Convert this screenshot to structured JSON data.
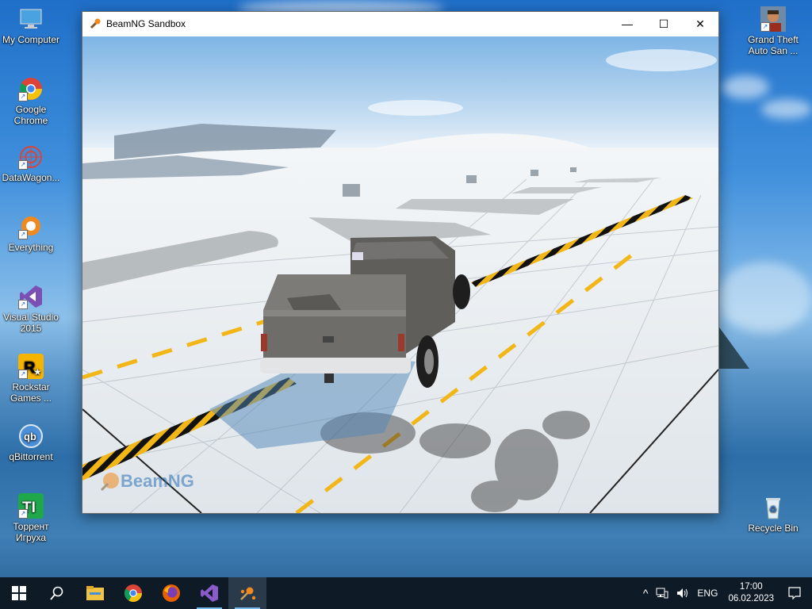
{
  "desktop": {
    "icons_left": [
      {
        "label": "My Computer",
        "icon": "computer-icon"
      },
      {
        "label": "Google Chrome",
        "icon": "chrome-icon"
      },
      {
        "label": "DataWagon...",
        "icon": "datawagon-icon"
      },
      {
        "label": "Everything",
        "icon": "everything-icon"
      },
      {
        "label": "Visual Studio 2015",
        "icon": "visual-studio-icon"
      },
      {
        "label": "Rockstar Games ...",
        "icon": "rockstar-icon"
      },
      {
        "label": "qBittorrent",
        "icon": "qbittorrent-icon"
      },
      {
        "label": "Торрент Игруха",
        "icon": "torrent-igruha-icon"
      }
    ],
    "icons_right": [
      {
        "label": "Grand Theft Auto San ...",
        "icon": "gta-icon"
      },
      {
        "label": "Recycle Bin",
        "icon": "recycle-bin-icon"
      }
    ]
  },
  "window": {
    "title": "BeamNG Sandbox",
    "controls": {
      "minimize": "—",
      "maximize": "☐",
      "close": "✕"
    },
    "watermark": "BeamNG"
  },
  "taskbar": {
    "apps": [
      "windows-start-icon",
      "search-icon",
      "file-explorer-icon",
      "chrome-icon",
      "firefox-icon",
      "visual-studio-icon",
      "beamng-icon"
    ],
    "tray": {
      "chevron": "^",
      "language": "ENG",
      "time": "17:00",
      "date": "06.02.2023"
    }
  },
  "colors": {
    "taskbar": "#0e1a26",
    "accent": "#76b9ed",
    "stripe_yellow": "#f2b617"
  }
}
